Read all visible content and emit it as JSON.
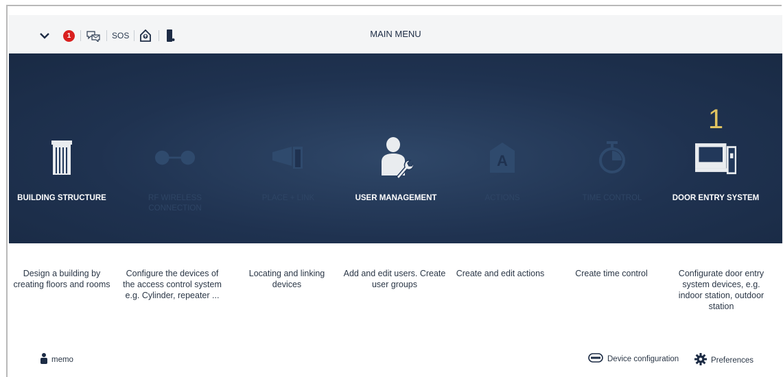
{
  "header": {
    "title": "MAIN MENU",
    "notification_count": "1",
    "sos_label": "SOS",
    "icons": [
      "chevron-down-icon",
      "notification-badge",
      "messages-icon",
      "sos",
      "house-upload-icon",
      "door-phone-icon"
    ]
  },
  "menu": {
    "items": [
      {
        "label": "BUILDING STRUCTURE",
        "icon": "building-icon",
        "state": "enabled",
        "description": "Design a building by creating floors and rooms"
      },
      {
        "label": "RF WIRELESS CONNECTION",
        "icon": "link-icon",
        "state": "disabled",
        "description": "Configure the devices of the access control system e.g. Cylinder, repeater ..."
      },
      {
        "label": "PLACE + LINK",
        "icon": "place-link-icon",
        "state": "disabled",
        "description": "Locating and linking devices"
      },
      {
        "label": "USER MANAGEMENT",
        "icon": "user-wrench-icon",
        "state": "enabled",
        "description": "Add and edit users. Create user groups"
      },
      {
        "label": "ACTIONS",
        "icon": "actions-icon",
        "state": "disabled",
        "description": "Create and edit actions"
      },
      {
        "label": "TIME CONTROL",
        "icon": "stopwatch-icon",
        "state": "disabled",
        "description": "Create time control"
      },
      {
        "label": "DOOR ENTRY SYSTEM",
        "icon": "door-entry-icon",
        "state": "enabled",
        "count": "1",
        "description": "Configurate door entry system devices, e.g. indoor station, outdoor station"
      }
    ]
  },
  "footer": {
    "user_label": "memo",
    "device_config_label": "Device configuration",
    "preferences_label": "Preferences"
  },
  "colors": {
    "banner": "#1f3250",
    "enabled_icon": "#e9ecef",
    "disabled_icon": "#2f4a6d",
    "accent_count": "#e0c361",
    "badge": "#d9201f"
  }
}
